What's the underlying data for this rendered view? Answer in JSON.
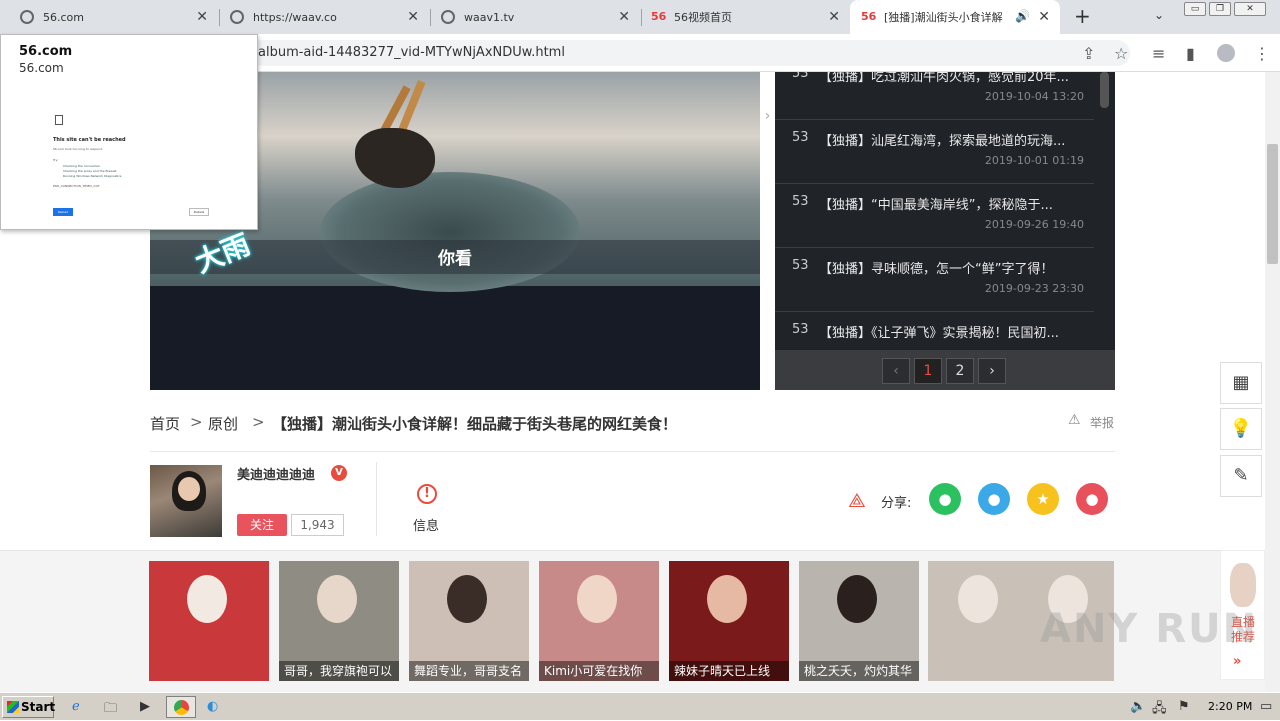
{
  "browser": {
    "tabs": [
      {
        "title": "56.com",
        "icon": "globe-icon"
      },
      {
        "title": "https://waav.co",
        "icon": "globe-icon"
      },
      {
        "title": "waav1.tv",
        "icon": "globe-icon"
      },
      {
        "title": "56视频首页",
        "icon": "logo-56"
      },
      {
        "title": "[独播]潮汕街头小食详解",
        "icon": "logo-56",
        "active": true
      }
    ],
    "logo_56": "56",
    "new_tab": "+",
    "url": "album-aid-14483277_vid-MTYwNjAxNDUw.html",
    "window_controls": [
      "▭",
      "❐",
      "✕"
    ]
  },
  "error_popup": {
    "title": "56.com",
    "subtitle": "56.com",
    "heading": "This site can't be reached",
    "body": "56.com took too long to respond.",
    "try_label": "Try:",
    "suggestions": [
      "Checking the connection",
      "Checking the proxy and the firewall",
      "Running Windows Network Diagnostics"
    ],
    "error_code": "ERR_CONNECTION_TIMED_OUT",
    "reload_label": "Reload",
    "details_label": "Details"
  },
  "player": {
    "subtitle": "你看",
    "watermark_text": "大雨",
    "side_arrow": "›"
  },
  "playlist": {
    "items": [
      {
        "num": "53",
        "title": "【独播】吃过潮汕牛肉火锅，感觉前20年...",
        "date": "2019-10-04 13:20"
      },
      {
        "num": "53",
        "title": "【独播】汕尾红海湾，探索最地道的玩海...",
        "date": "2019-10-01 01:19"
      },
      {
        "num": "53",
        "title": "【独播】“中国最美海岸线”，探秘隐于...",
        "date": "2019-09-26 19:40"
      },
      {
        "num": "53",
        "title": "【独播】寻味顺德，怎一个“鲜”字了得！",
        "date": "2019-09-23 23:30"
      },
      {
        "num": "53",
        "title": "【独播】《让子弹飞》实景揭秘！民国初...",
        "date": ""
      }
    ],
    "pager": {
      "prev": "‹",
      "pages": [
        "1",
        "2"
      ],
      "next": "›",
      "current": "1"
    }
  },
  "breadcrumb": {
    "home": "首页",
    "category": "原创",
    "title": "【独播】潮汕街头小食详解！细品藏于街头巷尾的网红美食！",
    "sep": ">"
  },
  "report": {
    "label": "举报",
    "icon": "⚠"
  },
  "uploader": {
    "name": "美迪迪迪迪迪",
    "badge": "V",
    "follow_label": "关注",
    "follower_count": "1,943"
  },
  "info": {
    "label": "信息",
    "icon": "!"
  },
  "share": {
    "label": "分享:",
    "targets": [
      {
        "name": "wechat",
        "color": "#2bc160",
        "glyph": "●"
      },
      {
        "name": "qq",
        "color": "#3ba8e8",
        "glyph": "●"
      },
      {
        "name": "qzone",
        "color": "#f7c21d",
        "glyph": "★"
      },
      {
        "name": "weibo",
        "color": "#e8505b",
        "glyph": "●"
      }
    ]
  },
  "recommendations": [
    {
      "caption": "",
      "bg": "#c9383a"
    },
    {
      "caption": "哥哥，我穿旗袍可以",
      "bg": "#8f8c84"
    },
    {
      "caption": "舞蹈专业，哥哥支名",
      "bg": "#cdbfb6"
    },
    {
      "caption": "Kimi小可爱在找你",
      "bg": "#c88a88"
    },
    {
      "caption": "辣妹子晴天已上线",
      "bg": "#7a1a1a"
    },
    {
      "caption": "桃之夭夭，灼灼其华",
      "bg": "#b9b4ae"
    },
    {
      "caption": "",
      "bg": "#c9c1b8"
    }
  ],
  "live": {
    "label": "直播推荐",
    "arrow": "»"
  },
  "side_buttons": [
    "qr-code-icon",
    "lightbulb-icon",
    "edit-icon"
  ],
  "taskbar": {
    "start_label": "Start",
    "clock": "2:20 PM"
  },
  "watermark": "ANY RUN"
}
